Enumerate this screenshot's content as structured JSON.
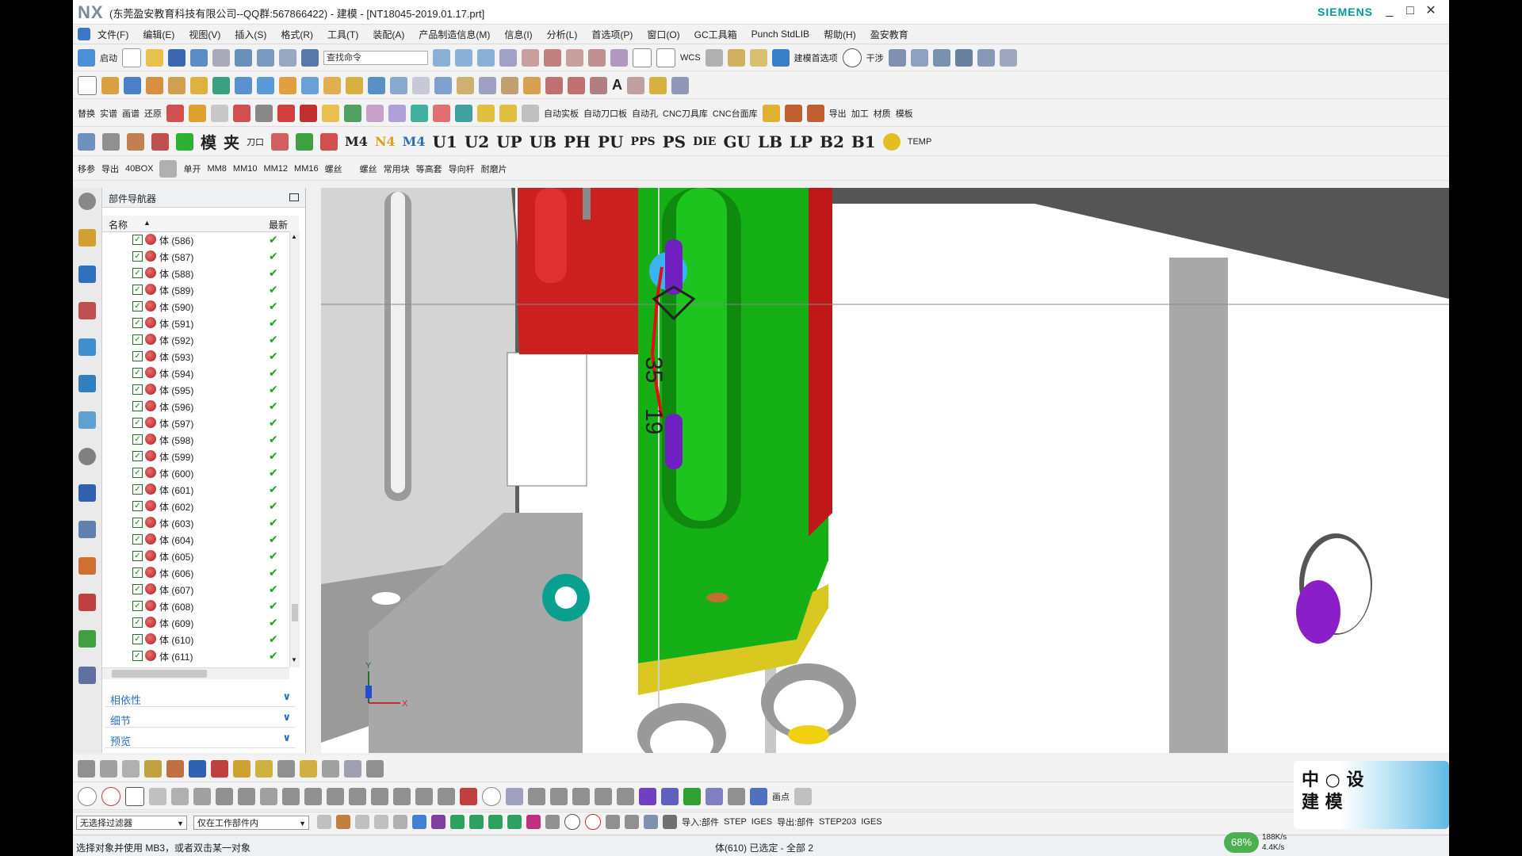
{
  "window": {
    "app_logo": "NX",
    "title": "(东莞盈安教育科技有限公司--QQ群:567866422) - 建模 - [NT18045-2019.01.17.prt]",
    "brand": "SIEMENS",
    "controls": [
      "_",
      "□",
      "✕"
    ]
  },
  "menu": [
    "文件(F)",
    "编辑(E)",
    "视图(V)",
    "插入(S)",
    "格式(R)",
    "工具(T)",
    "装配(A)",
    "产品制造信息(M)",
    "信息(I)",
    "分析(L)",
    "首选项(P)",
    "窗口(O)",
    "GC工具箱",
    "Punch StdLIB",
    "帮助(H)",
    "盈安教育"
  ],
  "toolbar1": {
    "start_label": "启动",
    "search_placeholder": "查找命令",
    "wcs_label": "WCS",
    "modeling_prefs": "建模首选项",
    "interfere": "干涉"
  },
  "toolbar3": {
    "items": [
      "替换",
      "实谱",
      "画谱",
      "还原",
      "自动实板",
      "自动刀口板",
      "自动孔",
      "CNC刀具库",
      "CNC台面库",
      "导出",
      "加工",
      "材质",
      "模板"
    ]
  },
  "toolbar4": {
    "big_labels": [
      "模",
      "夹",
      "刀口",
      "M4",
      "N4",
      "M4",
      "U1",
      "U2",
      "UP",
      "UB",
      "PH",
      "PU",
      "PPS",
      "PS",
      "DIE",
      "GU",
      "LB",
      "LP",
      "B2",
      "B1",
      "TEMP"
    ]
  },
  "toolbar5": {
    "items": [
      "移参",
      "导出",
      "40BOX",
      "单开",
      "MM8",
      "MM10",
      "MM12",
      "MM16",
      "螺丝",
      "螺丝",
      "常用块",
      "等高套",
      "导向杆",
      "耐磨片"
    ]
  },
  "navigator": {
    "title": "部件导航器",
    "col_name": "名称",
    "col_latest": "最新",
    "rows": [
      "体 (586)",
      "体 (587)",
      "体 (588)",
      "体 (589)",
      "体 (590)",
      "体 (591)",
      "体 (592)",
      "体 (593)",
      "体 (594)",
      "体 (595)",
      "体 (596)",
      "体 (597)",
      "体 (598)",
      "体 (599)",
      "体 (600)",
      "体 (601)",
      "体 (602)",
      "体 (603)",
      "体 (604)",
      "体 (605)",
      "体 (606)",
      "体 (607)",
      "体 (608)",
      "体 (609)",
      "体 (610)",
      "体 (611)"
    ],
    "sections": [
      "相依性",
      "细节",
      "预览"
    ]
  },
  "viewport": {
    "dim_text": "35",
    "dim_text2": "19",
    "axis_x": "X",
    "axis_y": "Y"
  },
  "bottom": {
    "filter": "无选择过滤器",
    "scope": "仅在工作部件内",
    "point_label": "画点",
    "import_part": "导入:部件",
    "step": "STEP",
    "iges": "IGES",
    "export_part": "导出:部件",
    "step203": "STEP203",
    "iges2": "IGES"
  },
  "status": {
    "hint": "选择对象并使用 MB3，或者双击某一对象",
    "selection": "体(610) 已选定 - 全部 2"
  },
  "watermark": {
    "text": "中 ○ 设 建 模"
  },
  "network": {
    "percent": "68%",
    "up": "188K/s",
    "down": "4.4K/s"
  }
}
